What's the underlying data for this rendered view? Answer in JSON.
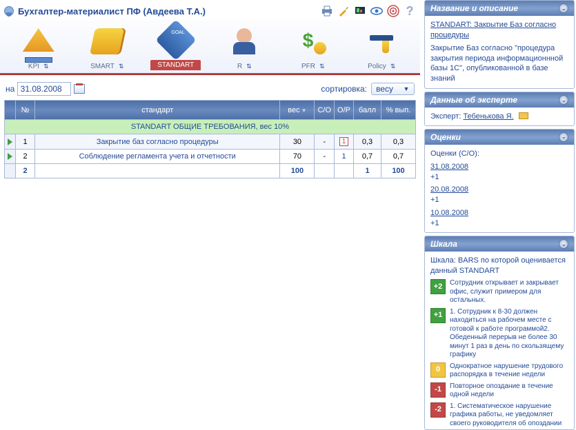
{
  "header": {
    "title": "Бухгалтер-материалист ПФ (Авдеева Т.А.)"
  },
  "tabs": [
    {
      "key": "kpi",
      "label": "KPI"
    },
    {
      "key": "smart",
      "label": "SMART"
    },
    {
      "key": "standart",
      "label": "STANDART"
    },
    {
      "key": "r",
      "label": "R"
    },
    {
      "key": "pfr",
      "label": "PFR"
    },
    {
      "key": "policy",
      "label": "Policy"
    }
  ],
  "active_tab": "STANDART",
  "filter": {
    "date_label": "на",
    "date_value": "31.08.2008",
    "sort_label": "сортировка:",
    "sort_value": "весу"
  },
  "table": {
    "headers": {
      "num": "№",
      "standard": "стандарт",
      "weight": "вес",
      "co": "C/O",
      "op": "O/P",
      "score": "балл",
      "pct": "% вып."
    },
    "section": "STANDART ОБЩИЕ ТРЕБОВАНИЯ, вес 10%",
    "rows": [
      {
        "n": "1",
        "name": "Закрытие баз согласно процедуры",
        "weight": "30",
        "co": "-",
        "op": "1",
        "op_red": true,
        "score": "0,3",
        "pct": "0,3"
      },
      {
        "n": "2",
        "name": "Соблюдение регламента учета и отчетности",
        "weight": "70",
        "co": "-",
        "op": "1",
        "op_red": false,
        "score": "0,7",
        "pct": "0,7"
      }
    ],
    "totals": {
      "n": "2",
      "weight": "100",
      "score": "1",
      "pct": "100"
    }
  },
  "side": {
    "desc": {
      "title": "Название и описание",
      "line1": "STANDART: Закрытие Баз согласно процедуры",
      "line2": "Закрытие Баз согласно \"процедура закрытия периода информационнной базы 1С\", опубликованной в базе знаний"
    },
    "expert": {
      "title": "Данные об эксперте",
      "label": "Эксперт:",
      "name": "Тебенькова Я."
    },
    "ratings": {
      "title": "Оценки",
      "subtitle": "Оценки (С/О):",
      "items": [
        {
          "date": "31.08.2008",
          "val": "+1"
        },
        {
          "date": "20.08.2008",
          "val": "+1"
        },
        {
          "date": "10.08.2008",
          "val": "+1"
        }
      ]
    },
    "scale": {
      "title": "Шкала",
      "subtitle": "Шкала: BARS по которой оценивается данный STANDART",
      "items": [
        {
          "badge": "+2",
          "color": "#3fa13f",
          "text": "Сотрудник открывает и закрывает офис, служит примером для остальных."
        },
        {
          "badge": "+1",
          "color": "#3fa13f",
          "text": "1. Сотрудник к 8-30 должен находиться на рабочем месте с готовой к работе программой2. Обеденный перерыв не более 30 минут 1 раз в день по скользящему графику"
        },
        {
          "badge": "0",
          "color": "#f2c441",
          "text": "Однократное нарушение трудового распорядка в течение недели"
        },
        {
          "badge": "-1",
          "color": "#c24848",
          "text": "Повторное опоздание в течение одной недели"
        },
        {
          "badge": "-2",
          "color": "#c24848",
          "text": "1. Систематическое нарушение графика работы, не уведомляет своего руководителя об опоздании"
        }
      ]
    }
  }
}
